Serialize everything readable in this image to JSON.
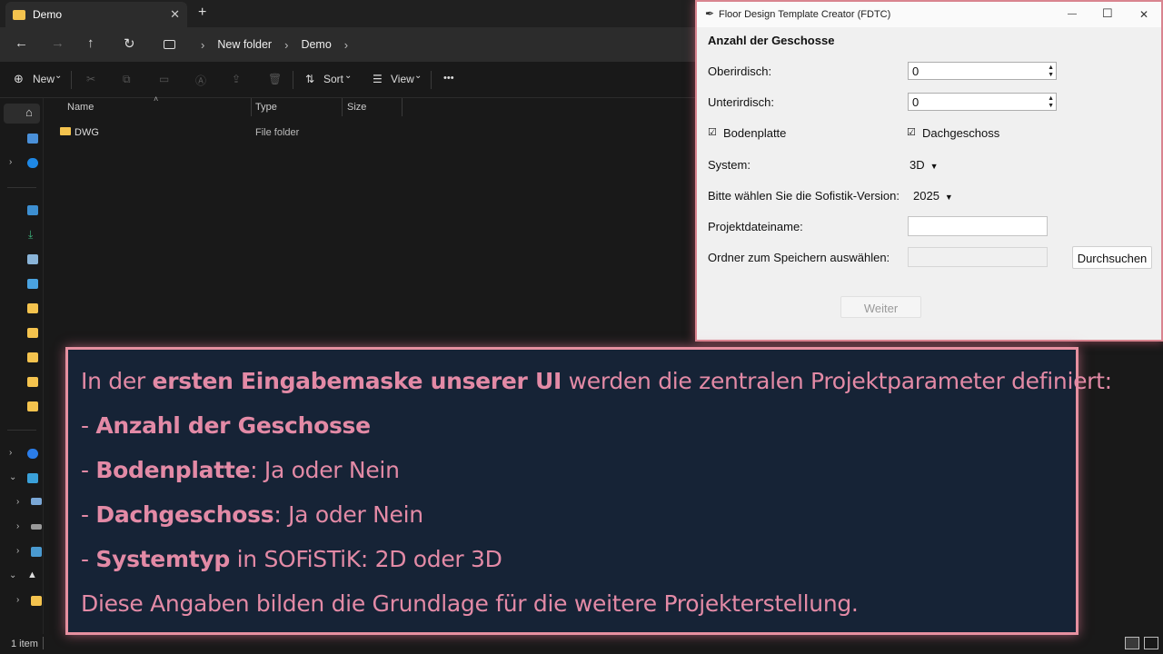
{
  "explorer": {
    "tab": {
      "label": "Demo",
      "close": "✕"
    },
    "new_tab": "+",
    "nav": {
      "back": "←",
      "forward": "→",
      "up": "↑",
      "refresh": "↻"
    },
    "breadcrumb": [
      "New folder",
      "Demo"
    ],
    "breadcrumb_sep": "›",
    "toolbar": {
      "new": "New",
      "sort": "Sort",
      "view": "View",
      "more": "•••",
      "new_icon": "⊕",
      "dropdown": "⌄"
    },
    "columns": [
      "Name",
      "Type",
      "Size"
    ],
    "rows": [
      {
        "name": "DWG",
        "type": "File folder"
      }
    ],
    "status": "1 item"
  },
  "dialog": {
    "title": "Floor Design Template Creator (FDTC)",
    "window_buttons": {
      "minimize": "—",
      "maximize": "☐",
      "close": "✕"
    },
    "heading": "Anzahl der Geschosse",
    "oberirdisch": {
      "label": "Oberirdisch:",
      "value": "0"
    },
    "unterirdisch": {
      "label": "Unterirdisch:",
      "value": "0"
    },
    "bodenplatte": {
      "label": "Bodenplatte",
      "checked": true
    },
    "dachgeschoss": {
      "label": "Dachgeschoss",
      "checked": true
    },
    "system": {
      "label": "System:",
      "value": "3D"
    },
    "version": {
      "label": "Bitte wählen Sie die Sofistik-Version:",
      "value": "2025"
    },
    "projekt": {
      "label": "Projektdateiname:",
      "value": ""
    },
    "ordner": {
      "label": "Ordner zum Speichern auswählen:",
      "value": "",
      "browse": "Durchsuchen"
    },
    "weiter": "Weiter",
    "check_mark": "☑",
    "caret": "▼"
  },
  "overlay": {
    "line1": {
      "a": "In der ",
      "b": "ersten Eingabemaske unserer UI",
      "c": " werden die zentralen Projektparameter definiert:"
    },
    "line2": {
      "a": "- ",
      "b": "Anzahl der Geschosse"
    },
    "line3": {
      "a": "- ",
      "b": "Bodenplatte",
      "c": ": Ja oder Nein"
    },
    "line4": {
      "a": "- ",
      "b": "Dachgeschoss",
      "c": ": Ja oder Nein"
    },
    "line5": {
      "a": "- ",
      "b": "Systemtyp",
      "c": " in SOFiSTiK: 2D oder 3D"
    },
    "line6": "Diese Angaben bilden die Grundlage für die weitere Projekterstellung."
  },
  "colors": {
    "accent": "#e38aa6",
    "overlay_bg": "#162336",
    "folder": "#f4c34e"
  }
}
